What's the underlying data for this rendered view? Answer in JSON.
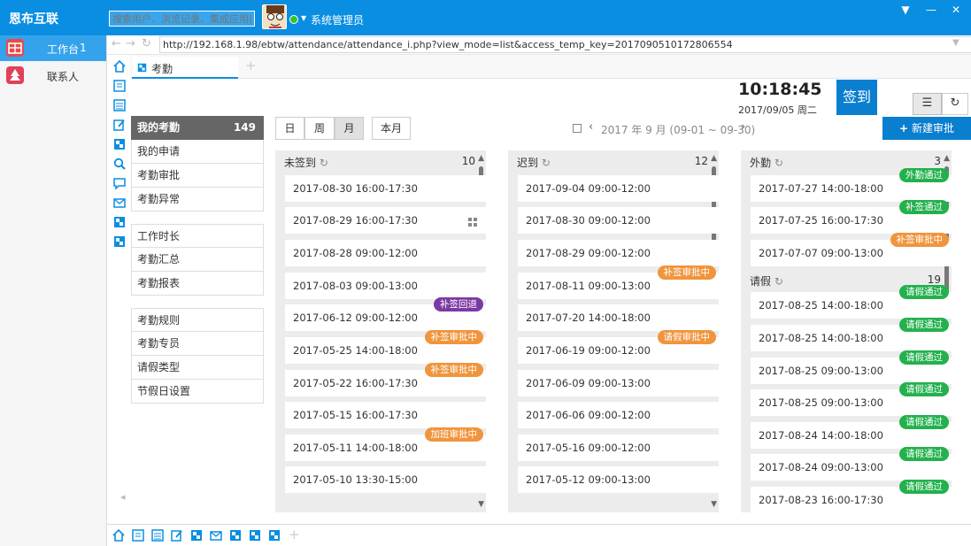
{
  "app": {
    "title": "恩布互联",
    "search_placeholder": "搜索用户、浏览记录、集成应用(/)",
    "user": "系统管理员"
  },
  "window": {
    "dropdown": "▼",
    "minimize": "—",
    "close": "✕"
  },
  "nav": {
    "items": [
      {
        "label": "工作台",
        "count": "1",
        "icon": "workbench-icon",
        "active": true
      },
      {
        "label": "联系人",
        "count": "",
        "icon": "contacts-icon",
        "active": false
      }
    ]
  },
  "address": {
    "url": "http://192.168.1.98/ebtw/attendance/attendance_i.php?view_mode=list&access_temp_key=2017090510172806554"
  },
  "tab": {
    "label": "考勤",
    "plus": "+"
  },
  "clock": {
    "time": "10:18:45",
    "date": "2017/09/05 周二"
  },
  "signin": {
    "label": "签到"
  },
  "submenu": {
    "group1": [
      {
        "label": "我的考勤",
        "count": "149"
      },
      {
        "label": "我的申请"
      },
      {
        "label": "考勤审批"
      },
      {
        "label": "考勤异常"
      }
    ],
    "group2": [
      {
        "label": "工作时长"
      },
      {
        "label": "考勤汇总"
      },
      {
        "label": "考勤报表"
      }
    ],
    "group3": [
      {
        "label": "考勤规则"
      },
      {
        "label": "考勤专员"
      },
      {
        "label": "请假类型"
      },
      {
        "label": "节假日设置"
      }
    ]
  },
  "toolbar": {
    "day": "日",
    "week": "周",
    "month": "月",
    "this_month": "本月",
    "period": "2017 年 9 月 (09-01 ~ 09-30)",
    "new_approval": "新建审批",
    "plus": "+"
  },
  "columns": [
    {
      "title": "未签到",
      "count": "10",
      "cards": [
        {
          "time": "2017-08-30 16:00-17:30"
        },
        {
          "time": "2017-08-29 16:00-17:30"
        },
        {
          "time": "2017-08-28 09:00-12:00"
        },
        {
          "time": "2017-08-03 09:00-13:00"
        },
        {
          "time": "2017-06-12 09:00-12:00",
          "badge": "补签回退",
          "color": "purple"
        },
        {
          "time": "2017-05-25 14:00-18:00",
          "badge": "补签审批中",
          "color": "orange"
        },
        {
          "time": "2017-05-22 16:00-17:30",
          "badge": "补签审批中",
          "color": "orange"
        },
        {
          "time": "2017-05-15 16:00-17:30"
        },
        {
          "time": "2017-05-11 14:00-18:00",
          "badge": "加班审批中",
          "color": "orange"
        },
        {
          "time": "2017-05-10 13:30-15:00"
        }
      ]
    },
    {
      "title": "迟到",
      "count": "12",
      "cards": [
        {
          "time": "2017-09-04 09:00-12:00"
        },
        {
          "time": "2017-08-30 09:00-12:00"
        },
        {
          "time": "2017-08-29 09:00-12:00"
        },
        {
          "time": "2017-08-11 09:00-13:00",
          "badge": "补签审批中",
          "color": "orange"
        },
        {
          "time": "2017-07-20 14:00-18:00"
        },
        {
          "time": "2017-06-19 09:00-12:00",
          "badge": "请假审批中",
          "color": "orange"
        },
        {
          "time": "2017-06-09 09:00-13:00"
        },
        {
          "time": "2017-06-06 09:00-12:00"
        },
        {
          "time": "2017-05-16 09:00-12:00"
        },
        {
          "time": "2017-05-12 09:00-13:00"
        }
      ]
    },
    {
      "title": "外勤",
      "count": "3",
      "cards": [
        {
          "time": "2017-07-27 14:00-18:00",
          "badge": "外勤通过",
          "color": "green"
        },
        {
          "time": "2017-07-25 16:00-17:30",
          "badge": "补签通过",
          "color": "green"
        },
        {
          "time": "2017-07-07 09:00-13:00",
          "badge": "补签审批中",
          "color": "orange"
        }
      ]
    },
    {
      "title": "请假",
      "count": "19",
      "cards": [
        {
          "time": "2017-08-25 14:00-18:00",
          "badge": "请假通过",
          "color": "green"
        },
        {
          "time": "2017-08-25 14:00-18:00",
          "badge": "请假通过",
          "color": "green"
        },
        {
          "time": "2017-08-25 09:00-13:00",
          "badge": "请假通过",
          "color": "green"
        },
        {
          "time": "2017-08-25 09:00-13:00",
          "badge": "请假通过",
          "color": "green"
        },
        {
          "time": "2017-08-24 14:00-18:00",
          "badge": "请假通过",
          "color": "green"
        },
        {
          "time": "2017-08-24 09:00-13:00",
          "badge": "请假通过",
          "color": "green"
        },
        {
          "time": "2017-08-23 16:00-17:30",
          "badge": "请假通过",
          "color": "green"
        }
      ]
    }
  ],
  "colors": {
    "titlebar": "#0a8ee2",
    "accent": "#0a7ecf",
    "purple": "#7b3aa3",
    "orange": "#f0953d",
    "green": "#23b14d"
  }
}
